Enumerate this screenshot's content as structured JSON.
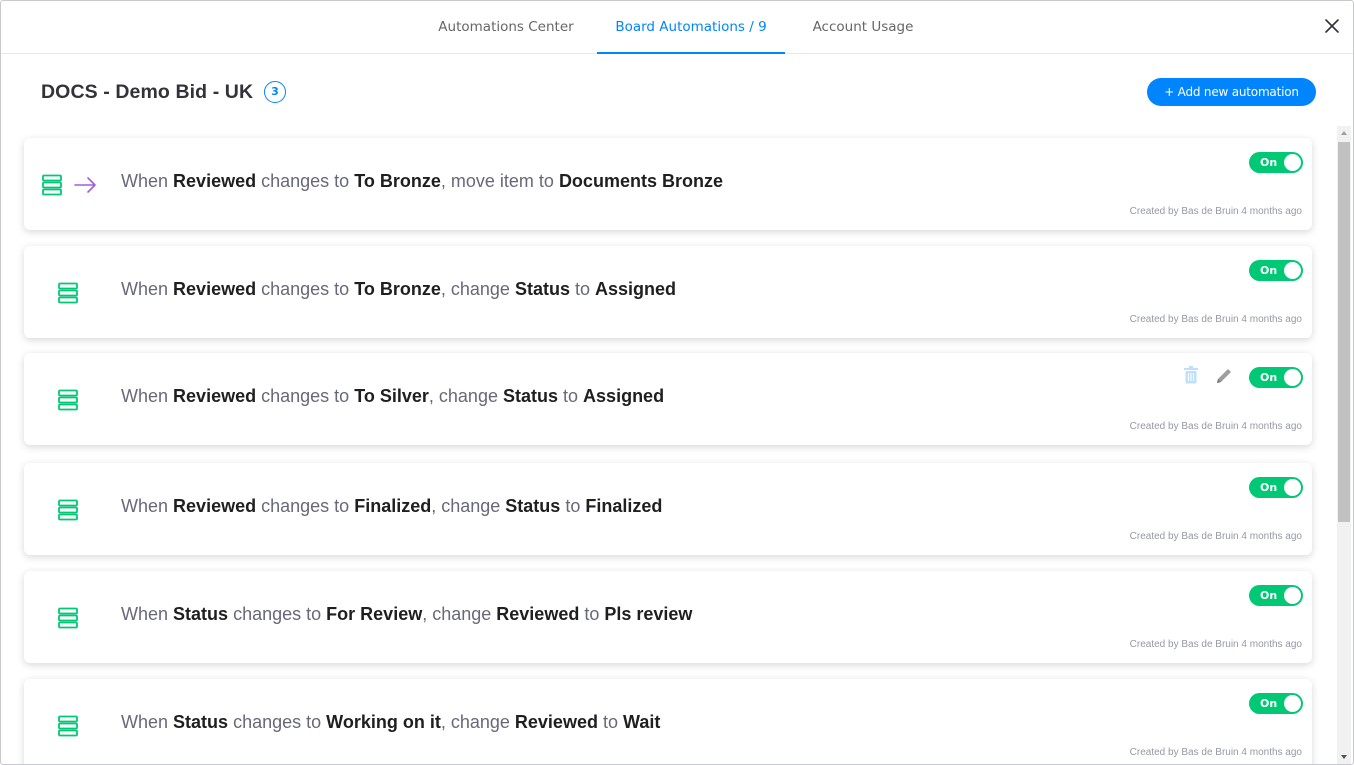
{
  "tabs": [
    {
      "label": "Automations Center"
    },
    {
      "label": "Board Automations / 9"
    },
    {
      "label": "Account Usage"
    }
  ],
  "board": {
    "title": "DOCS - Demo Bid - UK",
    "count": "3"
  },
  "add_button": "+ Add new automation",
  "colors": {
    "accent": "#0085ff",
    "toggle_on": "#00c875",
    "recipe_icon": "#00c875",
    "move_arrow": "#a25ddc"
  },
  "automations": [
    {
      "parts": [
        {
          "t": "When",
          "b": false
        },
        {
          "t": "Reviewed",
          "b": true
        },
        {
          "t": "changes to",
          "b": false
        },
        {
          "t": "To Bronze",
          "b": true
        },
        {
          "t": ", move item to",
          "b": false
        },
        {
          "t": "Documents Bronze",
          "b": true
        }
      ],
      "toggle": "On",
      "created": "Created by Bas de Bruin 4 months ago",
      "icon": "move-arrow"
    },
    {
      "parts": [
        {
          "t": "When",
          "b": false
        },
        {
          "t": "Reviewed",
          "b": true
        },
        {
          "t": "changes to",
          "b": false
        },
        {
          "t": "To Bronze",
          "b": true
        },
        {
          "t": ", change",
          "b": false
        },
        {
          "t": "Status",
          "b": true
        },
        {
          "t": "to",
          "b": false
        },
        {
          "t": "Assigned",
          "b": true
        }
      ],
      "toggle": "On",
      "created": "Created by Bas de Bruin 4 months ago"
    },
    {
      "parts": [
        {
          "t": "When",
          "b": false
        },
        {
          "t": "Reviewed",
          "b": true
        },
        {
          "t": "changes to",
          "b": false
        },
        {
          "t": "To Silver",
          "b": true
        },
        {
          "t": ", change",
          "b": false
        },
        {
          "t": "Status",
          "b": true
        },
        {
          "t": "to",
          "b": false
        },
        {
          "t": "Assigned",
          "b": true
        }
      ],
      "toggle": "On",
      "created": "Created by Bas de Bruin 4 months ago",
      "hovered": true
    },
    {
      "parts": [
        {
          "t": "When",
          "b": false
        },
        {
          "t": "Reviewed",
          "b": true
        },
        {
          "t": "changes to",
          "b": false
        },
        {
          "t": "Finalized",
          "b": true
        },
        {
          "t": ", change",
          "b": false
        },
        {
          "t": "Status",
          "b": true
        },
        {
          "t": "to",
          "b": false
        },
        {
          "t": "Finalized",
          "b": true
        }
      ],
      "toggle": "On",
      "created": "Created by Bas de Bruin 4 months ago"
    },
    {
      "parts": [
        {
          "t": "When",
          "b": false
        },
        {
          "t": "Status",
          "b": true
        },
        {
          "t": "changes to",
          "b": false
        },
        {
          "t": "For Review",
          "b": true
        },
        {
          "t": ", change",
          "b": false
        },
        {
          "t": "Reviewed",
          "b": true
        },
        {
          "t": "to",
          "b": false
        },
        {
          "t": "Pls review",
          "b": true
        }
      ],
      "toggle": "On",
      "created": "Created by Bas de Bruin 4 months ago"
    },
    {
      "parts": [
        {
          "t": "When",
          "b": false
        },
        {
          "t": "Status",
          "b": true
        },
        {
          "t": "changes to",
          "b": false
        },
        {
          "t": "Working on it",
          "b": true
        },
        {
          "t": ", change",
          "b": false
        },
        {
          "t": "Reviewed",
          "b": true
        },
        {
          "t": "to",
          "b": false
        },
        {
          "t": "Wait",
          "b": true
        }
      ],
      "toggle": "On",
      "created": "Created by Bas de Bruin 4 months ago"
    }
  ]
}
